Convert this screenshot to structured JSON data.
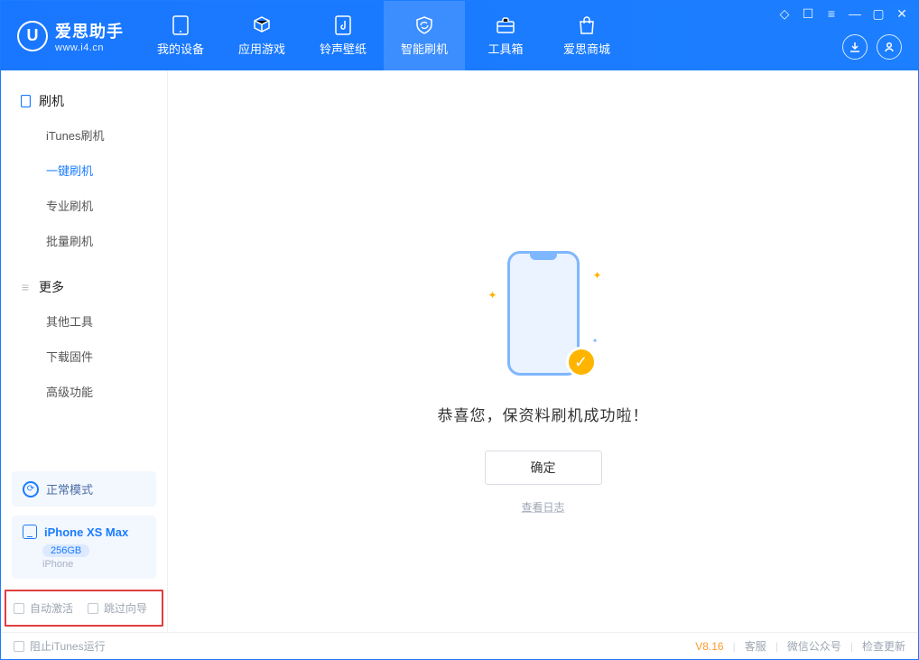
{
  "app": {
    "name": "爱思助手",
    "url": "www.i4.cn",
    "logo_letter": "U"
  },
  "header_tabs": {
    "device": "我的设备",
    "apps": "应用游戏",
    "ringtones": "铃声壁纸",
    "flash": "智能刷机",
    "toolbox": "工具箱",
    "store": "爱思商城"
  },
  "sidebar": {
    "flash_header": "刷机",
    "items_flash": {
      "itunes": "iTunes刷机",
      "onekey": "一键刷机",
      "pro": "专业刷机",
      "batch": "批量刷机"
    },
    "more_header": "更多",
    "items_more": {
      "other": "其他工具",
      "firmware": "下载固件",
      "advanced": "高级功能"
    },
    "mode_label": "正常模式",
    "device": {
      "name": "iPhone XS Max",
      "capacity": "256GB",
      "type": "iPhone"
    },
    "options": {
      "auto_activate": "自动激活",
      "skip_guide": "跳过向导"
    }
  },
  "main": {
    "success_text": "恭喜您，保资料刷机成功啦！",
    "ok_button": "确定",
    "view_log": "查看日志"
  },
  "statusbar": {
    "block_itunes": "阻止iTunes运行",
    "version": "V8.16",
    "support": "客服",
    "wechat": "微信公众号",
    "check_update": "检查更新"
  }
}
